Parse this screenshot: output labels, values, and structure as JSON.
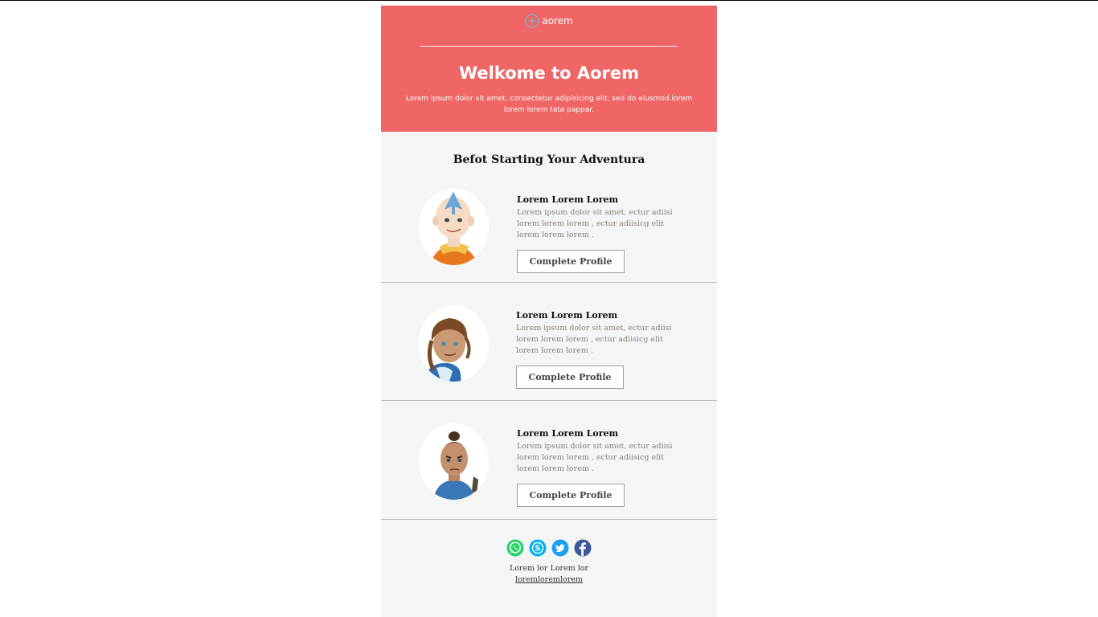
{
  "brand": {
    "name": "aorem",
    "logo_icon": "plus-circle-icon"
  },
  "hero": {
    "title": "Welkome to Aorem",
    "text": "Lorem ipsum dolor sit amet, consectetur adipisicing elit, sed do eiusmod.lorem lorem lorem tata pappar.",
    "background": "#f06565"
  },
  "section": {
    "title": "Befot Starting Your Adventura"
  },
  "cards": [
    {
      "avatar": "bald-monk-avatar",
      "heading": "Lorem Lorem Lorem",
      "text": "Lorem ipsum dolor sit amet, ectur adiisi lorem lorem lorem , ectur adiisicg elit lorem lorem lorem .",
      "button": "Complete Profile"
    },
    {
      "avatar": "water-girl-avatar",
      "heading": "Lorem Lorem Lorem",
      "text": "Lorem ipsum dolor sit amet, ectur adiisi lorem lorem lorem , ectur adiisicg elit lorem lorem lorem .",
      "button": "Complete Profile"
    },
    {
      "avatar": "warrior-boy-avatar",
      "heading": "Lorem Lorem Lorem",
      "text": "Lorem ipsum dolor sit amet, ectur adiisi lorem lorem lorem , ectur adiisicg elit lorem lorem lorem .",
      "button": "Complete Profile"
    }
  ],
  "social": [
    "whatsapp-icon",
    "skype-icon",
    "twitter-icon",
    "facebook-icon"
  ],
  "footer": {
    "text": "Lorem lor Lorem lor",
    "link": "loremloremlorem"
  },
  "colors": {
    "hero": "#f06565",
    "body": "#f5f5f5",
    "muted_text": "#8a7f74",
    "whatsapp": "#25d366",
    "skype": "#00aff0",
    "twitter": "#1da1f2",
    "facebook": "#3b5998"
  }
}
